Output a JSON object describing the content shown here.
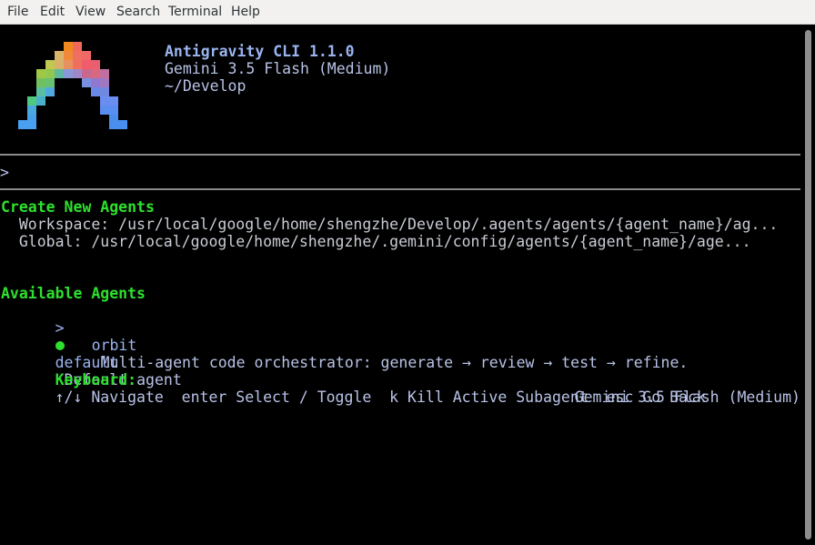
{
  "menu": {
    "file": "File",
    "edit": "Edit",
    "view": "View",
    "search": "Search",
    "terminal": "Terminal",
    "help": "Help"
  },
  "header": {
    "title": "Antigravity CLI 1.1.0",
    "model": "Gemini 3.5 Flash (Medium)",
    "cwd": "~/Develop"
  },
  "prompt": {
    "symbol": ">",
    "value": ""
  },
  "create": {
    "heading": "Create New Agents",
    "workspace": "  Workspace: /usr/local/google/home/shengzhe/Develop/.agents/agents/{agent_name}/ag...",
    "global": "  Global: /usr/local/google/home/shengzhe/.gemini/config/agents/{agent_name}/age..."
  },
  "available": {
    "heading": "Available Agents",
    "agents": [
      {
        "pointer": ">",
        "name": "default",
        "description": "Default agent",
        "selected": true
      },
      {
        "pointer": "",
        "name": "orbit",
        "description": "Multi-agent code orchestrator: generate → review → test → refine.",
        "selected": false
      }
    ]
  },
  "keyboard": {
    "label": "Keyboard:",
    "hints": "↑/↓ Navigate  enter Select / Toggle  k Kill Active Subagent  esc Go Back"
  },
  "status": {
    "model": "Gemini 3.5 Flash (Medium)"
  },
  "colors": {
    "background": "#000000",
    "heading_green": "#2ee02e",
    "title_blue": "#9ab4f0",
    "text_lavender": "#b8c2e6",
    "menubar": "#f2f1f0"
  }
}
